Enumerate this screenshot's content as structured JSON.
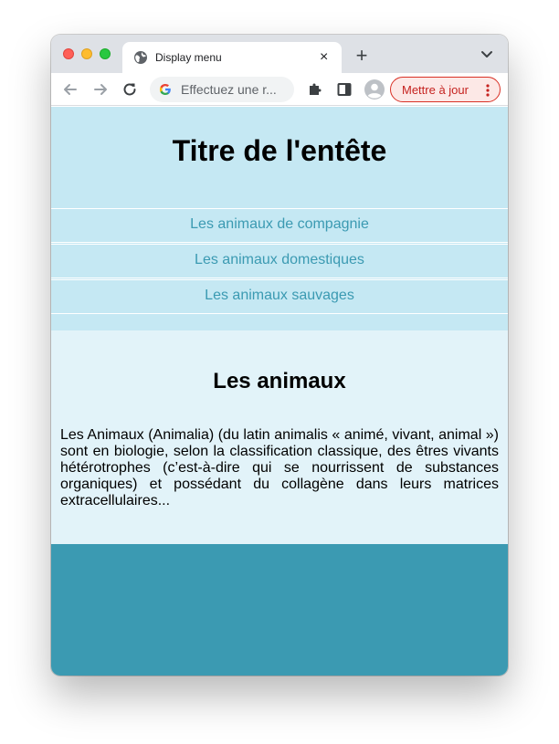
{
  "browser": {
    "tab": {
      "title": "Display menu",
      "close_glyph": "×"
    },
    "new_tab_glyph": "+",
    "omnibox": {
      "text": "Effectuez une r..."
    },
    "update_button": {
      "label": "Mettre à jour"
    },
    "icons": {
      "back": "back-arrow-icon",
      "forward": "forward-arrow-icon",
      "reload": "reload-icon",
      "extensions": "puzzle-icon",
      "sidepanel": "side-panel-icon",
      "profile": "profile-avatar-icon",
      "menu": "more-vertical-icon",
      "tab_search": "chevron-down-icon",
      "favicon": "globe-icon",
      "search_engine": "google-g-icon"
    }
  },
  "page": {
    "header": {
      "title": "Titre de l'entête"
    },
    "nav": [
      {
        "label": "Les animaux de compagnie"
      },
      {
        "label": "Les animaux domestiques"
      },
      {
        "label": "Les animaux sauvages"
      }
    ],
    "main": {
      "title": "Les animaux",
      "paragraph": "Les Animaux (Animalia) (du latin animalis « animé, vivant, animal ») sont en biologie, selon la classification classique, des êtres vivants hétérotrophes (c’est-à-dire qui se nourrissent de substances organiques) et possédant du collagène dans leurs matrices extracellulaires..."
    }
  },
  "colors": {
    "header_bg": "#c5e8f3",
    "main_bg": "#e2f3f9",
    "footer_bg": "#3b9ab2",
    "link": "#3b9ab2",
    "update_accent": "#c5221f"
  }
}
